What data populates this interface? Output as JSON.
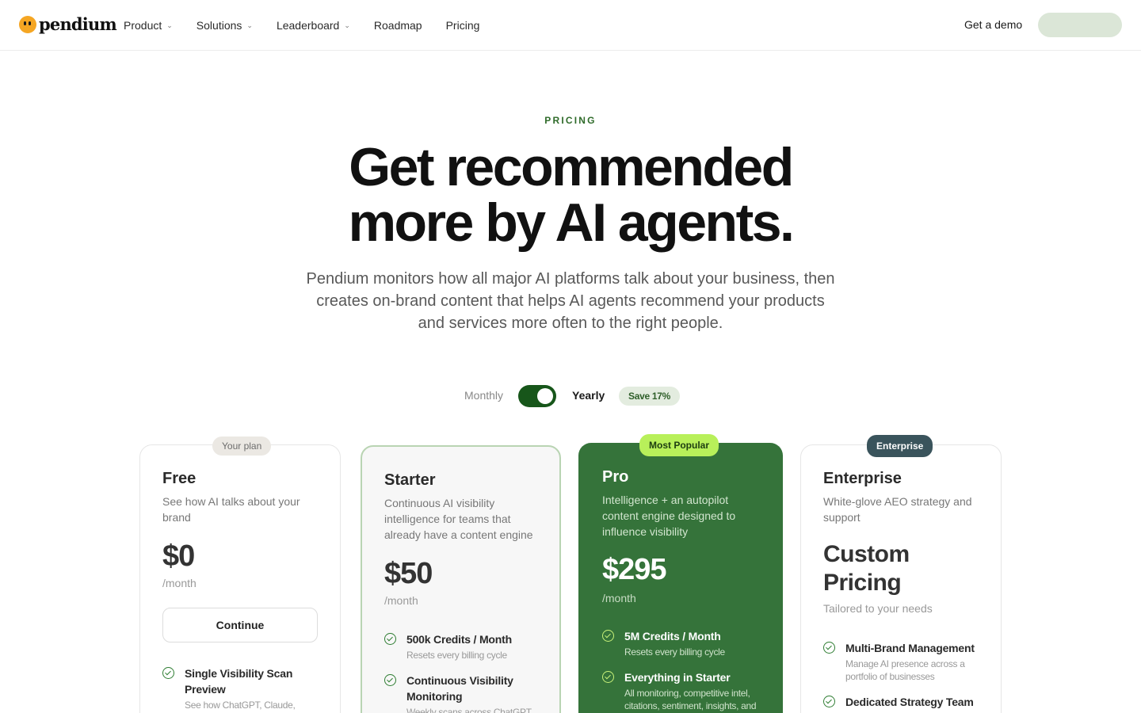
{
  "brand": {
    "name": "pendium"
  },
  "nav": {
    "items": [
      {
        "label": "Product",
        "has_dropdown": true
      },
      {
        "label": "Solutions",
        "has_dropdown": true
      },
      {
        "label": "Leaderboard",
        "has_dropdown": true
      },
      {
        "label": "Roadmap",
        "has_dropdown": false
      },
      {
        "label": "Pricing",
        "has_dropdown": false
      }
    ],
    "demo_label": "Get a demo",
    "chevron": "⌄"
  },
  "hero": {
    "eyebrow": "PRICING",
    "headline_line1": "Get recommended",
    "headline_line2": "more by AI agents.",
    "subhead": "Pendium monitors how all major AI platforms talk about your business, then creates on-brand content that helps AI agents recommend your products and services more often to the right people."
  },
  "billing": {
    "monthly_label": "Monthly",
    "yearly_label": "Yearly",
    "selected": "yearly",
    "save_badge": "Save 17%"
  },
  "plans": {
    "free": {
      "badge": "Your plan",
      "name": "Free",
      "desc": "See how AI talks about your brand",
      "price": "$0",
      "period": "/month",
      "button": "Continue",
      "features": [
        {
          "title": "Single Visibility Scan Preview",
          "sub": "See how ChatGPT, Claude,"
        }
      ]
    },
    "starter": {
      "name": "Starter",
      "desc": "Continuous AI visibility intelligence for teams that already have a content engine",
      "price": "$50",
      "period": "/month",
      "features": [
        {
          "title": "500k Credits / Month",
          "sub": "Resets every billing cycle"
        },
        {
          "title": "Continuous Visibility Monitoring",
          "sub": "Weekly scans across ChatGPT"
        }
      ]
    },
    "pro": {
      "badge": "Most Popular",
      "name": "Pro",
      "desc": "Intelligence + an autopilot content engine designed to influence visibility",
      "price": "$295",
      "period": "/month",
      "features": [
        {
          "title": "5M Credits / Month",
          "sub": "Resets every billing cycle"
        },
        {
          "title": "Everything in Starter",
          "sub": "All monitoring, competitive intel, citations, sentiment, insights, and"
        }
      ]
    },
    "enterprise": {
      "badge": "Enterprise",
      "name": "Enterprise",
      "desc": "White-glove AEO strategy and support",
      "price_line1": "Custom",
      "price_line2": "Pricing",
      "period": "Tailored to your needs",
      "features": [
        {
          "title": "Multi-Brand Management",
          "sub": "Manage AI presence across a portfolio of businesses"
        },
        {
          "title": "Dedicated Strategy Team",
          "sub": ""
        }
      ]
    }
  },
  "colors": {
    "accent_green": "#35733a",
    "toggle_green": "#17561a",
    "lime_badge": "#b8f05a",
    "enterprise_badge": "#3a545c"
  }
}
